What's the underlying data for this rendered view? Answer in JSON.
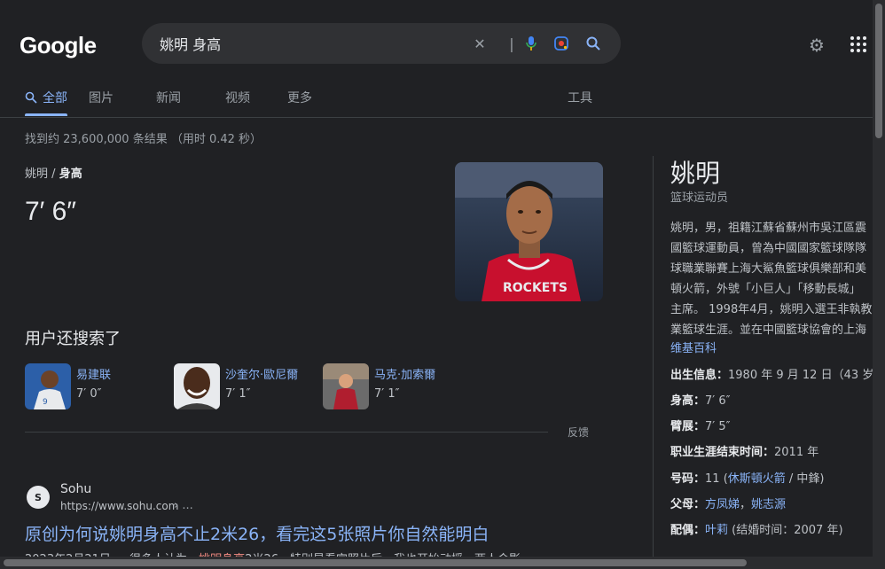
{
  "logo": "Google",
  "search": {
    "query": "姚明 身高",
    "icons": [
      "clear-icon",
      "mic-icon",
      "lens-icon",
      "search-icon"
    ]
  },
  "tabs": [
    {
      "label": "全部",
      "icon": "search-icon"
    },
    {
      "label": "图片"
    },
    {
      "label": "新闻"
    },
    {
      "label": "视频"
    },
    {
      "label": "更多"
    }
  ],
  "tools_label": "工具",
  "stats": "找到约 23,600,000 条结果 （用时 0.42 秒）",
  "answer": {
    "breadcrumb_parent": "姚明",
    "breadcrumb_sep": "/",
    "breadcrumb_current": "身高",
    "value": "7′ 6″"
  },
  "people_also_search": {
    "title": "用户还搜索了",
    "items": [
      {
        "name": "易建联",
        "height": "7′ 0″"
      },
      {
        "name": "沙奎尔·歐尼爾",
        "height": "7′ 1″"
      },
      {
        "name": "马克·加索爾",
        "height": "7′ 1″"
      }
    ]
  },
  "feedback_label": "反馈",
  "result": {
    "favicon_text": "S",
    "site": "Sohu",
    "url": "https://www.sohu.com",
    "url_more": "› ...",
    "title": "原创为何说姚明身高不止2米26，看完这5张照片你自然能明白",
    "snippet_date": "2023年2月21日 —",
    "snippet_pre": " 很多人认为，",
    "snippet_em": "姚明身高",
    "snippet_post": "2米26，特别是看完照片后，我也开始动摇，两人会影"
  },
  "knowledge_panel": {
    "title": "姚明",
    "subtitle": "篮球运动员",
    "description": "姚明，男，祖籍江蘇省蘇州市吳江區震\n國籃球運動員，曾為中國國家籃球隊隊\n球職業聯賽上海大鯊魚籃球俱樂部和美\n頓火箭，外號「小巨人」「移動長城」\n主席。 1998年4月，姚明入選王非執教\n業籃球生涯。並在中國籃球協會的上海",
    "wiki_label": "维基百科",
    "facts": {
      "birth_label": "出生信息：",
      "birth_value": "1980 年 9 月 12 日（43 岁）",
      "height_label": "身高：",
      "height_value": "7′ 6″",
      "arm_label": "臂展：",
      "arm_value": "7′ 5″",
      "career_end_label": "职业生涯结束时间：",
      "career_end_value": "2011 年",
      "number_label": "号码：",
      "number_pre": "11 (",
      "number_link": "休斯頓火箭",
      "number_post": " / 中鋒)",
      "parents_label": "父母：",
      "parent1": "方凤娣",
      "parent_sep": "，",
      "parent2": "姚志源",
      "spouse_label": "配偶：",
      "spouse_link": "叶莉",
      "spouse_post": " (结婚时间：2007 年)"
    }
  },
  "colors": {
    "background": "#202124",
    "link": "#8ab4f8",
    "text": "#bdc1c6",
    "highlight": "#f28b82"
  }
}
